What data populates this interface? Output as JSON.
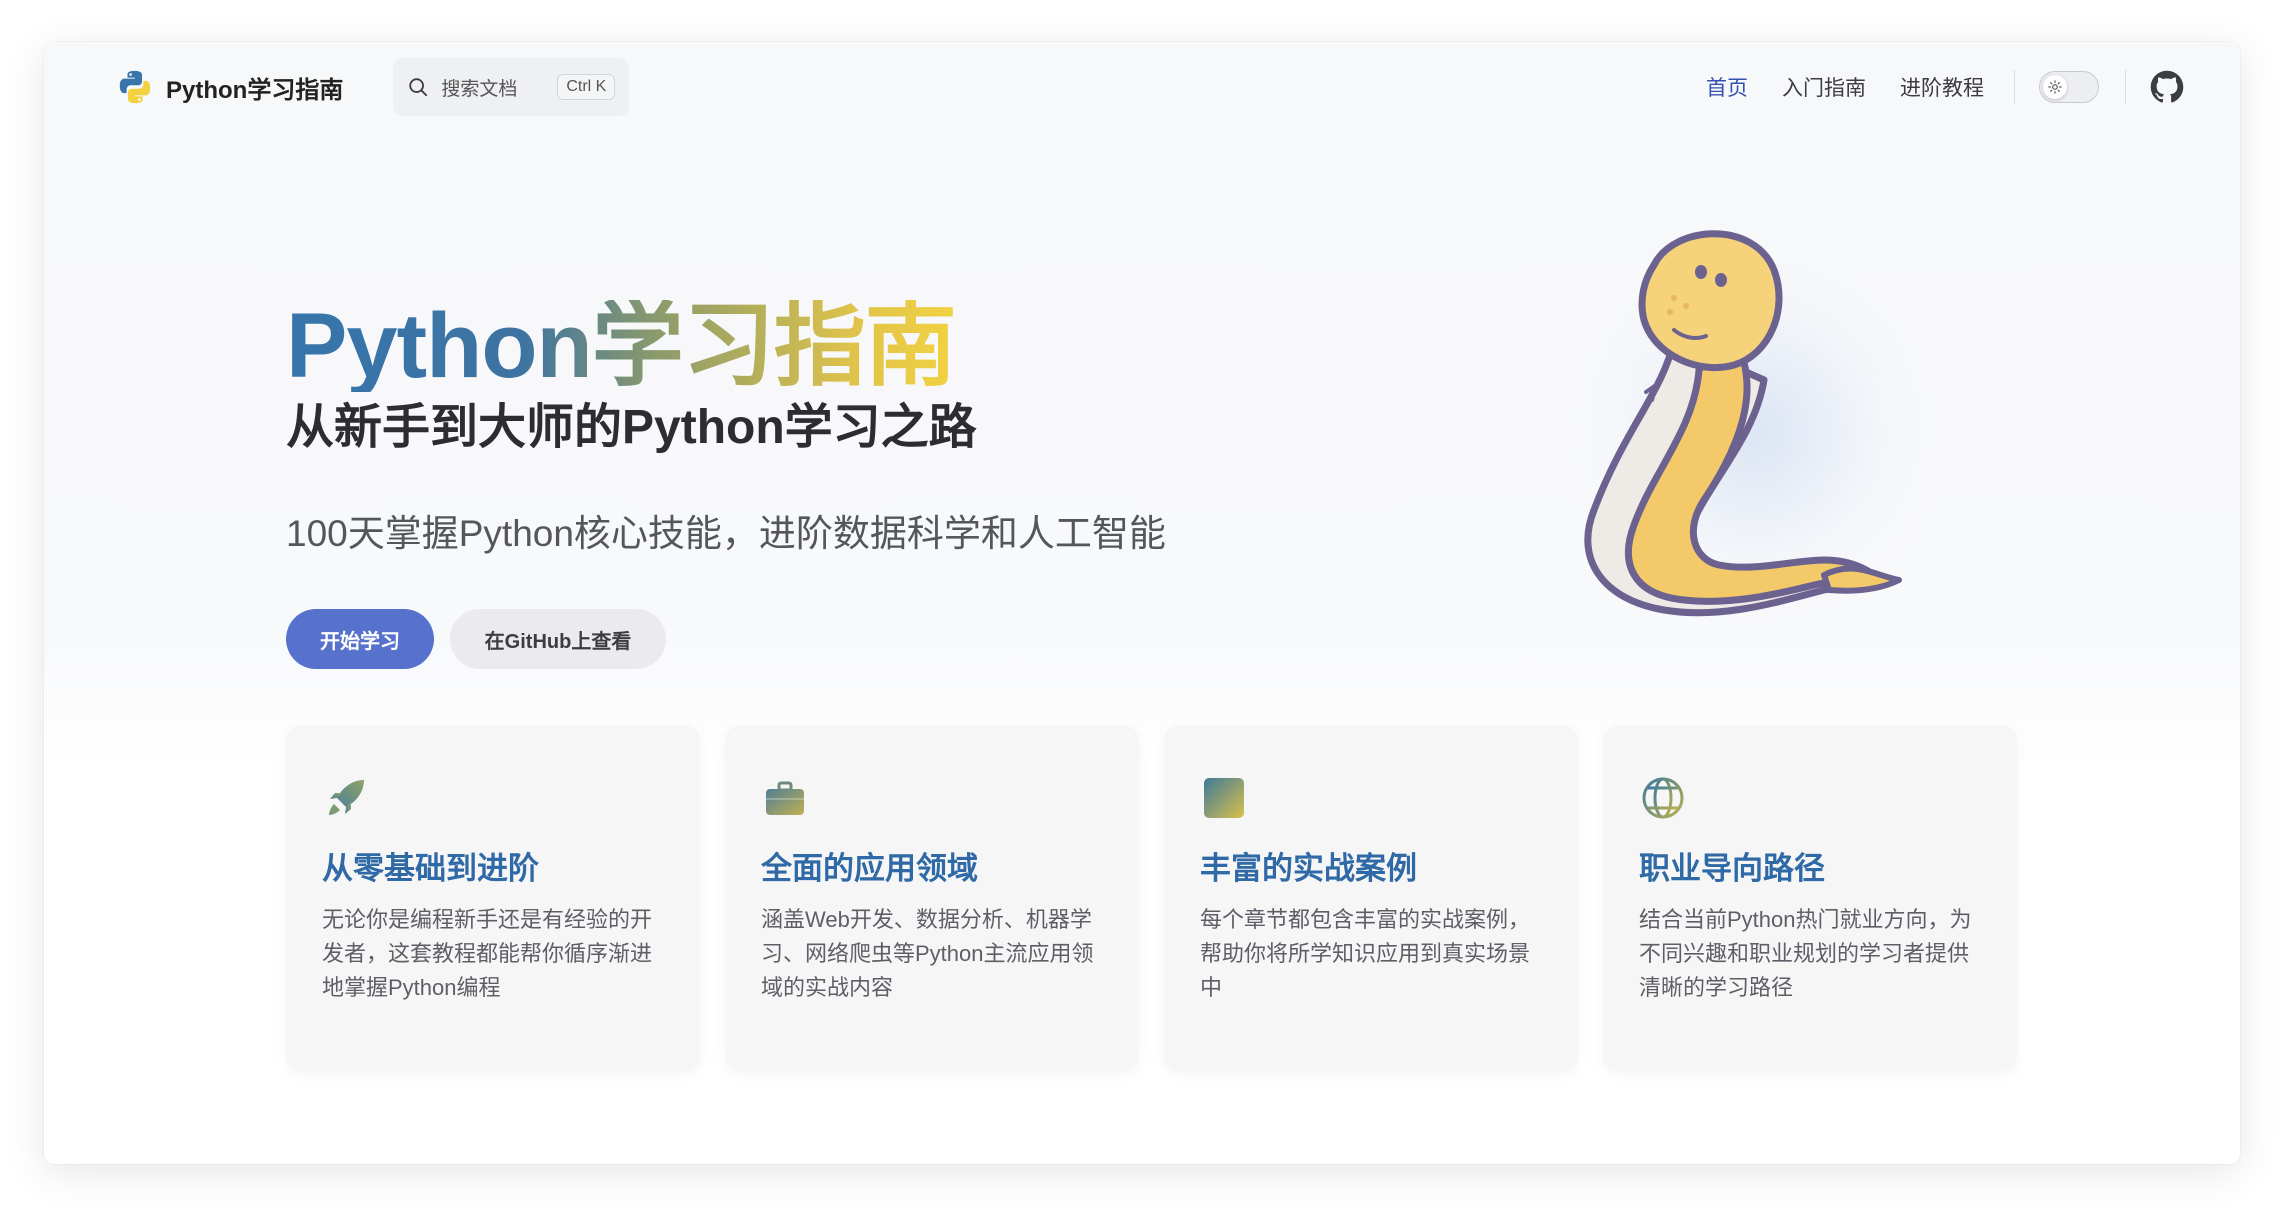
{
  "navbar": {
    "brand_title": "Python学习指南",
    "search_placeholder": "搜索文档",
    "search_shortcut": "Ctrl K",
    "links": [
      {
        "label": "首页",
        "active": true
      },
      {
        "label": "入门指南",
        "active": false
      },
      {
        "label": "进阶教程",
        "active": false
      }
    ],
    "theme_icon": "sun-icon",
    "social_icon": "github-icon"
  },
  "hero": {
    "name": "Python学习指南",
    "text": "从新手到大师的Python学习之路",
    "tagline": "100天掌握Python核心技能，进阶数据科学和人工智能",
    "actions": {
      "primary": "开始学习",
      "secondary": "在GitHub上查看"
    },
    "image_icon": "python-snake-illustration"
  },
  "features": [
    {
      "icon": "rocket-icon",
      "title": "从零基础到进阶",
      "details": "无论你是编程新手还是有经验的开发者，这套教程都能帮你循序渐进地掌握Python编程"
    },
    {
      "icon": "briefcase-icon",
      "title": "全面的应用领域",
      "details": "涵盖Web开发、数据分析、机器学习、网络爬虫等Python主流应用领域的实战内容"
    },
    {
      "icon": "square-icon",
      "title": "丰富的实战案例",
      "details": "每个章节都包含丰富的实战案例，帮助你将所学知识应用到真实场景中"
    },
    {
      "icon": "globe-icon",
      "title": "职业导向路径",
      "details": "结合当前Python热门就业方向，为不同兴趣和职业规划的学习者提供清晰的学习路径"
    }
  ],
  "colors": {
    "brand": "#3451b2",
    "primary_button": "#5672cd",
    "python_blue": "#3775ab",
    "python_yellow": "#f2d241"
  }
}
